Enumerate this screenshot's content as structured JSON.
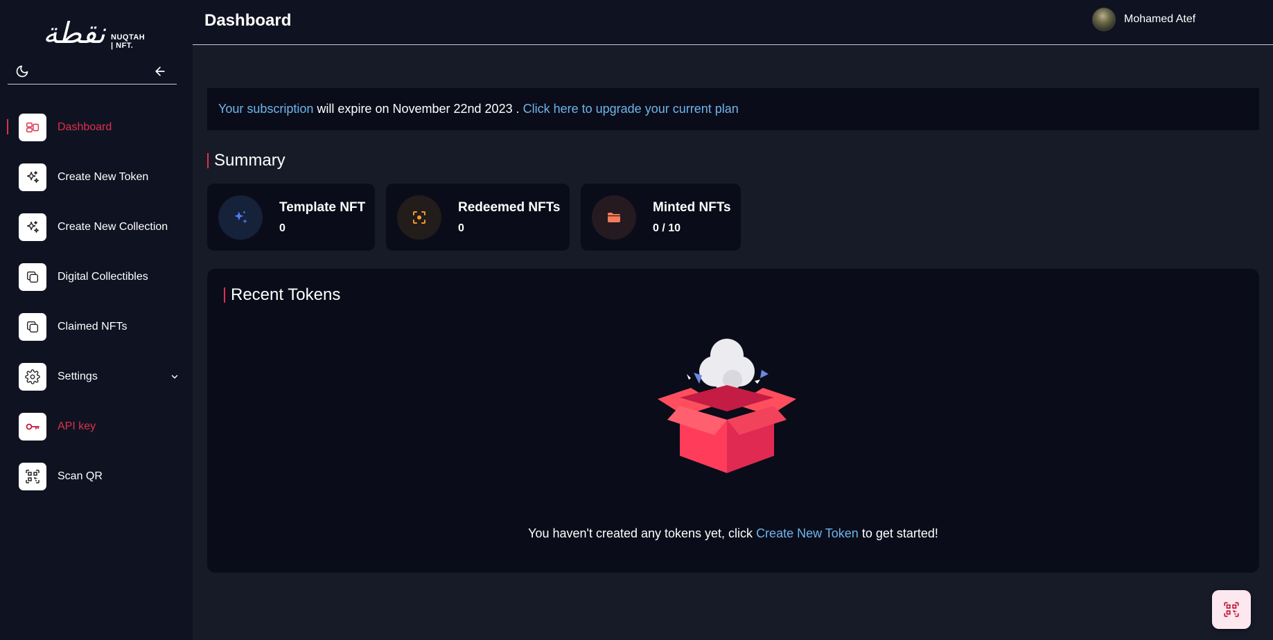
{
  "brand": {
    "script_text": "نقطة",
    "name_line1": "NUQTAH",
    "name_line2": "| NFT."
  },
  "header": {
    "title": "Dashboard",
    "user_name": "Mohamed Atef"
  },
  "sidebar": {
    "items": [
      {
        "label": "Dashboard",
        "icon": "dashboard-icon",
        "active": true
      },
      {
        "label": "Create New Token",
        "icon": "sparkles-icon"
      },
      {
        "label": "Create New Collection",
        "icon": "sparkles-icon"
      },
      {
        "label": "Digital Collectibles",
        "icon": "copy-icon"
      },
      {
        "label": "Claimed NFTs",
        "icon": "copy-icon"
      },
      {
        "label": "Settings",
        "icon": "gear-icon",
        "expandable": true
      },
      {
        "label": "API key",
        "icon": "key-icon"
      },
      {
        "label": "Scan QR",
        "icon": "qr-scan-icon"
      }
    ]
  },
  "banner": {
    "link1": "Your subscription",
    "middle": " will expire on November 22nd 2023 . ",
    "link2": "Click here to upgrade your current plan"
  },
  "summary": {
    "title": "Summary",
    "cards": [
      {
        "label": "Template NFT",
        "value": "0",
        "icon": "sparkles-icon",
        "icon_color": "#4e7ff2",
        "bg": "#16213a"
      },
      {
        "label": "Redeemed NFTs",
        "value": "0",
        "icon": "focus-icon",
        "icon_color": "#f29a2e",
        "bg": "#221c1a"
      },
      {
        "label": "Minted NFTs",
        "value": "0 / 10",
        "icon": "folder-icon",
        "icon_color": "#f47c5a",
        "bg": "#241a1f"
      }
    ]
  },
  "recent_tokens": {
    "title": "Recent Tokens",
    "empty_prefix": "You haven't created any tokens yet, click ",
    "empty_link": "Create New Token",
    "empty_suffix": " to get started!"
  },
  "colors": {
    "accent": "#e0304e",
    "link": "#6fb4ec",
    "background": "#171b28",
    "sidebar": "#0f1321",
    "card": "#0a0d19"
  }
}
